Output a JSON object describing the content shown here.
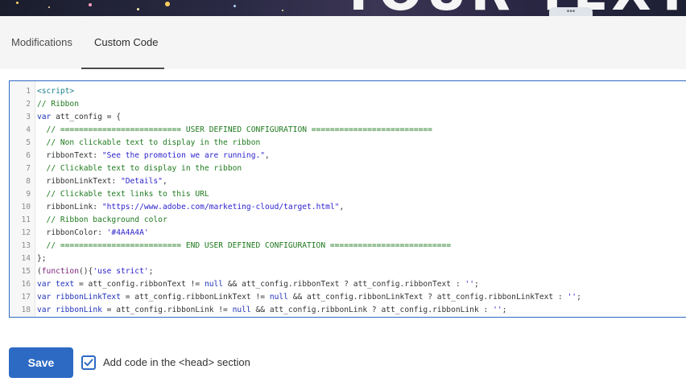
{
  "banner": {
    "text": "YOUR TEXT",
    "handle_glyph": "•••"
  },
  "tabs": [
    {
      "label": "Modifications",
      "active": false
    },
    {
      "label": "Custom Code",
      "active": true
    }
  ],
  "editor": {
    "lines": [
      {
        "n": "1",
        "tokens": [
          {
            "t": "<script>",
            "c": "tag"
          }
        ]
      },
      {
        "n": "2",
        "tokens": [
          {
            "t": "// Ribbon",
            "c": "comment"
          }
        ]
      },
      {
        "n": "3",
        "tokens": [
          {
            "t": "var",
            "c": "kw"
          },
          {
            "t": " att_config = {",
            "c": "plain"
          }
        ]
      },
      {
        "n": "4",
        "tokens": [
          {
            "t": "  // ========================== USER DEFINED CONFIGURATION ==========================",
            "c": "comment"
          }
        ]
      },
      {
        "n": "5",
        "tokens": [
          {
            "t": "  // Non clickable text to display in the ribbon",
            "c": "comment"
          }
        ]
      },
      {
        "n": "6",
        "tokens": [
          {
            "t": "  ribbonText: ",
            "c": "plain"
          },
          {
            "t": "\"See the promotion we are running.\"",
            "c": "str"
          },
          {
            "t": ",",
            "c": "plain"
          }
        ]
      },
      {
        "n": "7",
        "tokens": [
          {
            "t": "  // Clickable text to display in the ribbon",
            "c": "comment"
          }
        ]
      },
      {
        "n": "8",
        "tokens": [
          {
            "t": "  ribbonLinkText: ",
            "c": "plain"
          },
          {
            "t": "\"Details\"",
            "c": "str"
          },
          {
            "t": ",",
            "c": "plain"
          }
        ]
      },
      {
        "n": "9",
        "tokens": [
          {
            "t": "  // Clickable text links to this URL",
            "c": "comment"
          }
        ]
      },
      {
        "n": "10",
        "tokens": [
          {
            "t": "  ribbonLink: ",
            "c": "plain"
          },
          {
            "t": "\"https://www.adobe.com/marketing-cloud/target.html\"",
            "c": "str"
          },
          {
            "t": ",",
            "c": "plain"
          }
        ]
      },
      {
        "n": "11",
        "tokens": [
          {
            "t": "  // Ribbon background color",
            "c": "comment"
          }
        ]
      },
      {
        "n": "12",
        "tokens": [
          {
            "t": "  ribbonColor: ",
            "c": "plain"
          },
          {
            "t": "'#4A4A4A'",
            "c": "str"
          }
        ]
      },
      {
        "n": "13",
        "tokens": [
          {
            "t": "  // ========================== END USER DEFINED CONFIGURATION ==========================",
            "c": "comment"
          }
        ]
      },
      {
        "n": "14",
        "tokens": [
          {
            "t": "};",
            "c": "plain"
          }
        ]
      },
      {
        "n": "15",
        "tokens": [
          {
            "t": "(",
            "c": "plain"
          },
          {
            "t": "function",
            "c": "kwbold"
          },
          {
            "t": "(){",
            "c": "plain"
          },
          {
            "t": "'use strict'",
            "c": "str"
          },
          {
            "t": ";",
            "c": "plain"
          }
        ]
      },
      {
        "n": "16",
        "tokens": [
          {
            "t": "var",
            "c": "kw"
          },
          {
            "t": " ",
            "c": "plain"
          },
          {
            "t": "text",
            "c": "def"
          },
          {
            "t": " = att_config.ribbonText != ",
            "c": "plain"
          },
          {
            "t": "null",
            "c": "kw"
          },
          {
            "t": " && att_config.ribbonText ? att_config.ribbonText : ",
            "c": "plain"
          },
          {
            "t": "''",
            "c": "str"
          },
          {
            "t": ";",
            "c": "plain"
          }
        ]
      },
      {
        "n": "17",
        "tokens": [
          {
            "t": "var",
            "c": "kw"
          },
          {
            "t": " ",
            "c": "plain"
          },
          {
            "t": "ribbonLinkText",
            "c": "def"
          },
          {
            "t": " = att_config.ribbonLinkText != ",
            "c": "plain"
          },
          {
            "t": "null",
            "c": "kw"
          },
          {
            "t": " && att_config.ribbonLinkText ? att_config.ribbonLinkText : ",
            "c": "plain"
          },
          {
            "t": "''",
            "c": "str"
          },
          {
            "t": ";",
            "c": "plain"
          }
        ]
      },
      {
        "n": "18",
        "tokens": [
          {
            "t": "var",
            "c": "kw"
          },
          {
            "t": " ",
            "c": "plain"
          },
          {
            "t": "ribbonLink",
            "c": "def"
          },
          {
            "t": " = att_config.ribbonLink != ",
            "c": "plain"
          },
          {
            "t": "null",
            "c": "kw"
          },
          {
            "t": " && att_config.ribbonLink ? att_config.ribbonLink : ",
            "c": "plain"
          },
          {
            "t": "''",
            "c": "str"
          },
          {
            "t": ";",
            "c": "plain"
          }
        ]
      }
    ]
  },
  "footer": {
    "save_label": "Save",
    "checkbox_checked": true,
    "checkbox_label": "Add code in the <head> section"
  },
  "colors": {
    "accent": "#2d6ac4",
    "tab_underline": "#4b4b4b",
    "tab_background": "#f5f5f5"
  },
  "icons": {
    "checkbox": "checkmark-icon",
    "handle": "more-horizontal-icon"
  }
}
